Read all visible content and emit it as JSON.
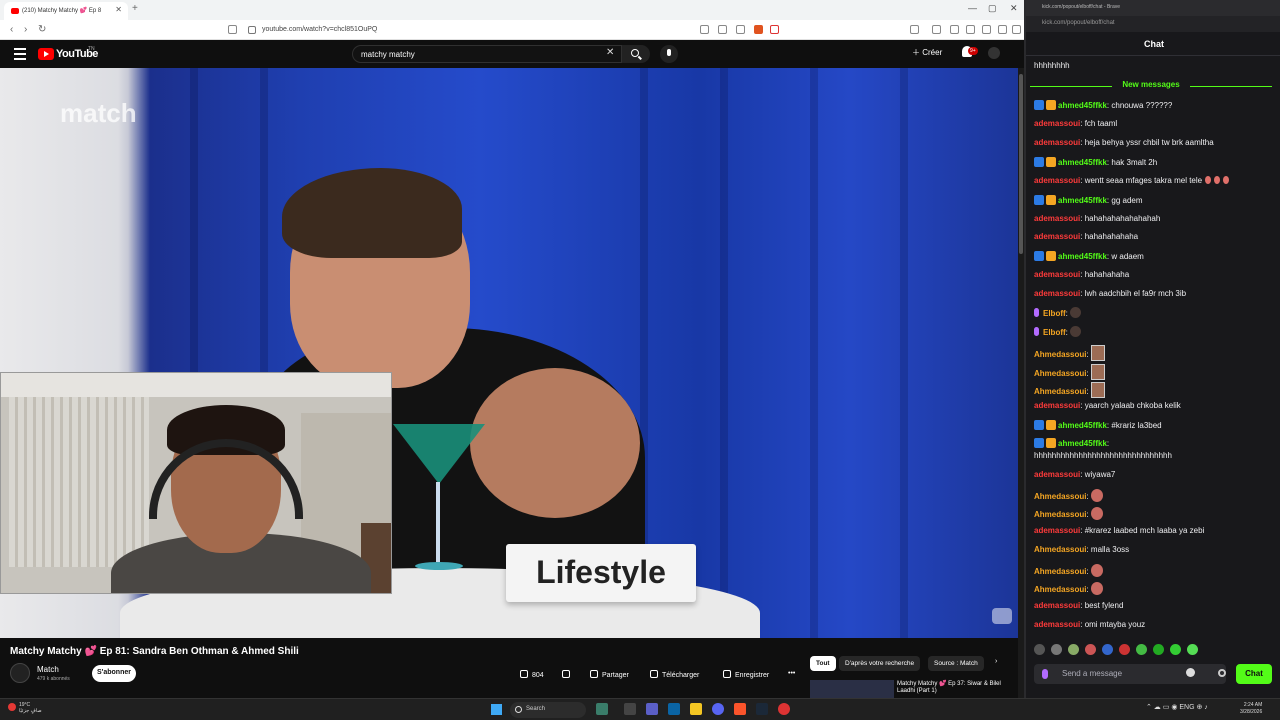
{
  "browser": {
    "tab_title": "(210) Matchy Matchy 💕 Ep 8",
    "url": "youtube.com/watch?v=chcl851OuPQ"
  },
  "youtube": {
    "logo_text": "YouTube",
    "logo_region": "TN",
    "search_query": "matchy matchy",
    "create_label": "Créer",
    "notif_count": "9+",
    "video_title": "Matchy Matchy 💕 Ep 81: Sandra Ben Othman & Ahmed Shili",
    "watermark": "match",
    "card_text": "Lifestyle",
    "channel_name": "Match",
    "channel_subs": "479 k abonnés",
    "subscribe_label": "S'abonner",
    "likes": "804",
    "share_label": "Partager",
    "download_label": "Télécharger",
    "save_label": "Enregistrer",
    "chips": [
      "Tout",
      "D'après votre recherche",
      "Source : Match"
    ],
    "rec_title": "Matchy Matchy 💕 Ep 37: Siwar & Bilel Laadhi (Part 1)"
  },
  "chat": {
    "tab_title": "kick.com/popout/elboff/chat - Brave",
    "url": "kick.com/popout/elboff/chat",
    "header": "Chat",
    "prev_message": "hhhhhhhh",
    "new_messages_label": "New messages",
    "input_placeholder": "Send a message",
    "send_label": "Chat",
    "colors": {
      "accent": "#53fc18",
      "red_user": "#ff3b3b",
      "green_user": "#53fc18",
      "gold_user": "#f5a623"
    },
    "messages": [
      {
        "user": "ahmed45ffkk",
        "text": ": chnouwa ??????"
      },
      {
        "user": "ademassoui",
        "text": ": fch taaml"
      },
      {
        "user": "ademassoui",
        "text": ": heja behya yssr chbil tw brk aamltha"
      },
      {
        "user": "ahmed45ffkk",
        "text": ": hak 3malt 2h"
      },
      {
        "user": "ademassoui",
        "text": ": wentt seaa mfages takra mel tele"
      },
      {
        "user": "ahmed45ffkk",
        "text": ": gg adem"
      },
      {
        "user": "ademassoui",
        "text": ": hahahahahahahahah"
      },
      {
        "user": "ademassoui",
        "text": ": hahahahahaha"
      },
      {
        "user": "ahmed45ffkk",
        "text": ": w adaem"
      },
      {
        "user": "ademassoui",
        "text": ": hahahahaha"
      },
      {
        "user": "ademassoui",
        "text": ": lwh aadchbih el fa9r mch 3ib"
      },
      {
        "user": "Elboff",
        "text": ":"
      },
      {
        "user": "Elboff",
        "text": ":"
      },
      {
        "user": "Ahmedassoui",
        "text": ":"
      },
      {
        "user": "Ahmedassoui",
        "text": ":"
      },
      {
        "user": "Ahmedassoui",
        "text": ":"
      },
      {
        "user": "ademassoui",
        "text": ": yaarch yalaab chkoba kelik"
      },
      {
        "user": "ahmed45ffkk",
        "text": ": #krariz la3bed"
      },
      {
        "user": "ahmed45ffkk",
        "text": ":"
      },
      {
        "user": "",
        "text": "hhhhhhhhhhhhhhhhhhhhhhhhhhhhhhh"
      },
      {
        "user": "ademassoui",
        "text": ": wiyawa7"
      },
      {
        "user": "Ahmedassoui",
        "text": ":"
      },
      {
        "user": "Ahmedassoui",
        "text": ":"
      },
      {
        "user": "ademassoui",
        "text": ": #krarez laabed mch laaba ya zebi"
      },
      {
        "user": "Ahmedassoui",
        "text": ": malla 3oss"
      },
      {
        "user": "Ahmedassoui",
        "text": ":"
      },
      {
        "user": "Ahmedassoui",
        "text": ":"
      },
      {
        "user": "ademassoui",
        "text": ": best fylend"
      },
      {
        "user": "ademassoui",
        "text": ": omi mtayba youz"
      }
    ]
  },
  "taskbar": {
    "weather_temp": "19°C",
    "weather_desc": "صافٍ جزئيًا",
    "search_label": "Search",
    "lang": "ENG",
    "time": "2:24 AM",
    "date": "3/28/2026"
  }
}
